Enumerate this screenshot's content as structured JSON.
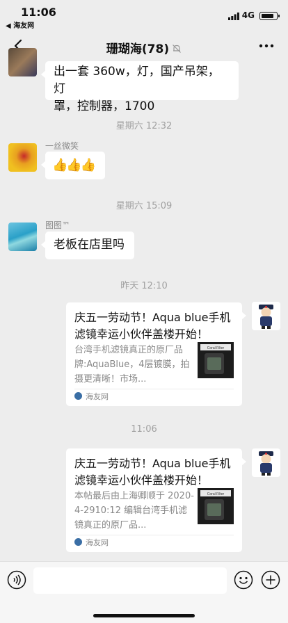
{
  "status": {
    "time": "11:06",
    "back_app": "◀ 海友网",
    "network": "4G"
  },
  "nav": {
    "title": "珊瑚海(78)",
    "back_icon": "chevron-left-icon",
    "mute_icon": "bell-muted-icon",
    "more_icon": "ellipsis-icon"
  },
  "messages": [
    {
      "type": "text",
      "text_line1": "出一套 360w，灯，国产吊架，灯",
      "text_line2": "罩，控制器，1700"
    },
    {
      "type": "time",
      "text": "星期六 12:32"
    },
    {
      "type": "text",
      "sender": "一丝微笑",
      "text": "👍👍👍"
    },
    {
      "type": "time",
      "text": "星期六 15:09"
    },
    {
      "type": "text",
      "sender": "图图™",
      "text": "老板在店里吗"
    },
    {
      "type": "time",
      "text": "昨天 12:10"
    },
    {
      "type": "link_card",
      "title": "庆五一劳动节！Aqua blue手机滤镜幸运小伙伴盖楼开始！",
      "desc": "台湾手机滤镜真正的原厂品牌:AquaBlue，4层镀膜，拍摄更清晰！市场...",
      "thumb_label": "Coral Filter",
      "source": "海友网"
    },
    {
      "type": "time",
      "text": "11:06"
    },
    {
      "type": "link_card",
      "title": "庆五一劳动节！Aqua blue手机滤镜幸运小伙伴盖楼开始！",
      "desc": "本帖最后由上海卿顺于 2020-4-2910:12 编辑台湾手机滤镜真正的原厂品...",
      "thumb_label": "Coral Filter",
      "source": "海友网"
    }
  ],
  "input_bar": {
    "voice_icon": "voice-icon",
    "emoji_icon": "emoji-icon",
    "plus_icon": "plus-icon"
  }
}
